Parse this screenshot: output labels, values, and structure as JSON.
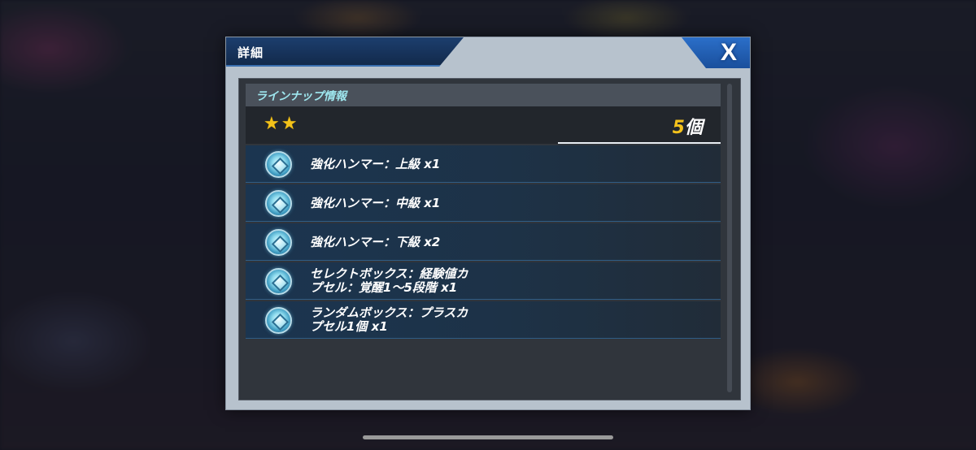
{
  "dialog": {
    "title": "詳細",
    "close_label": "X"
  },
  "lineup": {
    "section_title": "ラインナップ情報",
    "rarity": {
      "stars": [
        "★",
        "★"
      ],
      "count_number": "5",
      "count_unit": "個"
    },
    "items": [
      {
        "icon": "capsule-icon",
        "name": "強化ハンマー：上級 x1"
      },
      {
        "icon": "capsule-icon",
        "name": "強化ハンマー：中級 x1"
      },
      {
        "icon": "capsule-icon",
        "name": "強化ハンマー：下級 x2"
      },
      {
        "icon": "capsule-icon",
        "name": "セレクトボックス：経験値カ\nプセル：覚醒1～5段階 x1"
      },
      {
        "icon": "capsule-icon",
        "name": "ランダムボックス：プラスカ\nプセル1個 x1"
      }
    ]
  },
  "colors": {
    "star": "#f3c21a",
    "count_number": "#f4c21c",
    "section_title": "#9ee6ee",
    "close_button": "#2b6fc9",
    "title_tab": "#1c3e6e"
  }
}
